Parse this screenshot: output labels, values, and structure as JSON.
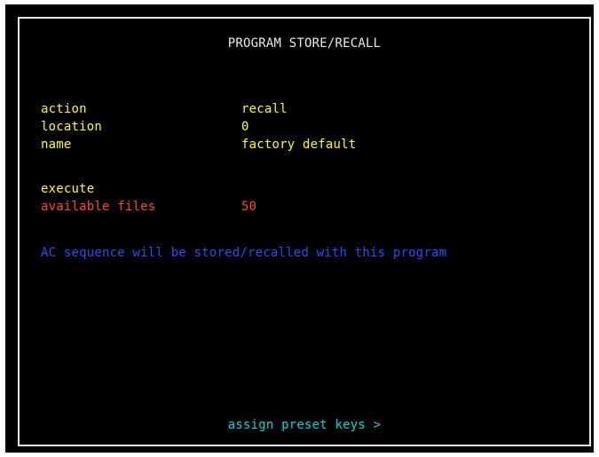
{
  "screen": {
    "title": "PROGRAM STORE/RECALL"
  },
  "fields": [
    {
      "label": "action",
      "value": "recall"
    },
    {
      "label": "location",
      "value": "0"
    },
    {
      "label": "name",
      "value": "factory default"
    }
  ],
  "execute_label": "execute",
  "available_files": {
    "label": "available files",
    "value": "50"
  },
  "note": "AC sequence will be stored/recalled with this program",
  "assign_preset_keys": "assign preset keys >",
  "colors": {
    "background": "#000000",
    "frame_border": "#e8e8e8",
    "title": "#e8e8e8",
    "field_text": "#ffff00",
    "available_files": "#ff4a1a",
    "note": "#2a4bff",
    "link": "#00d8e0"
  }
}
